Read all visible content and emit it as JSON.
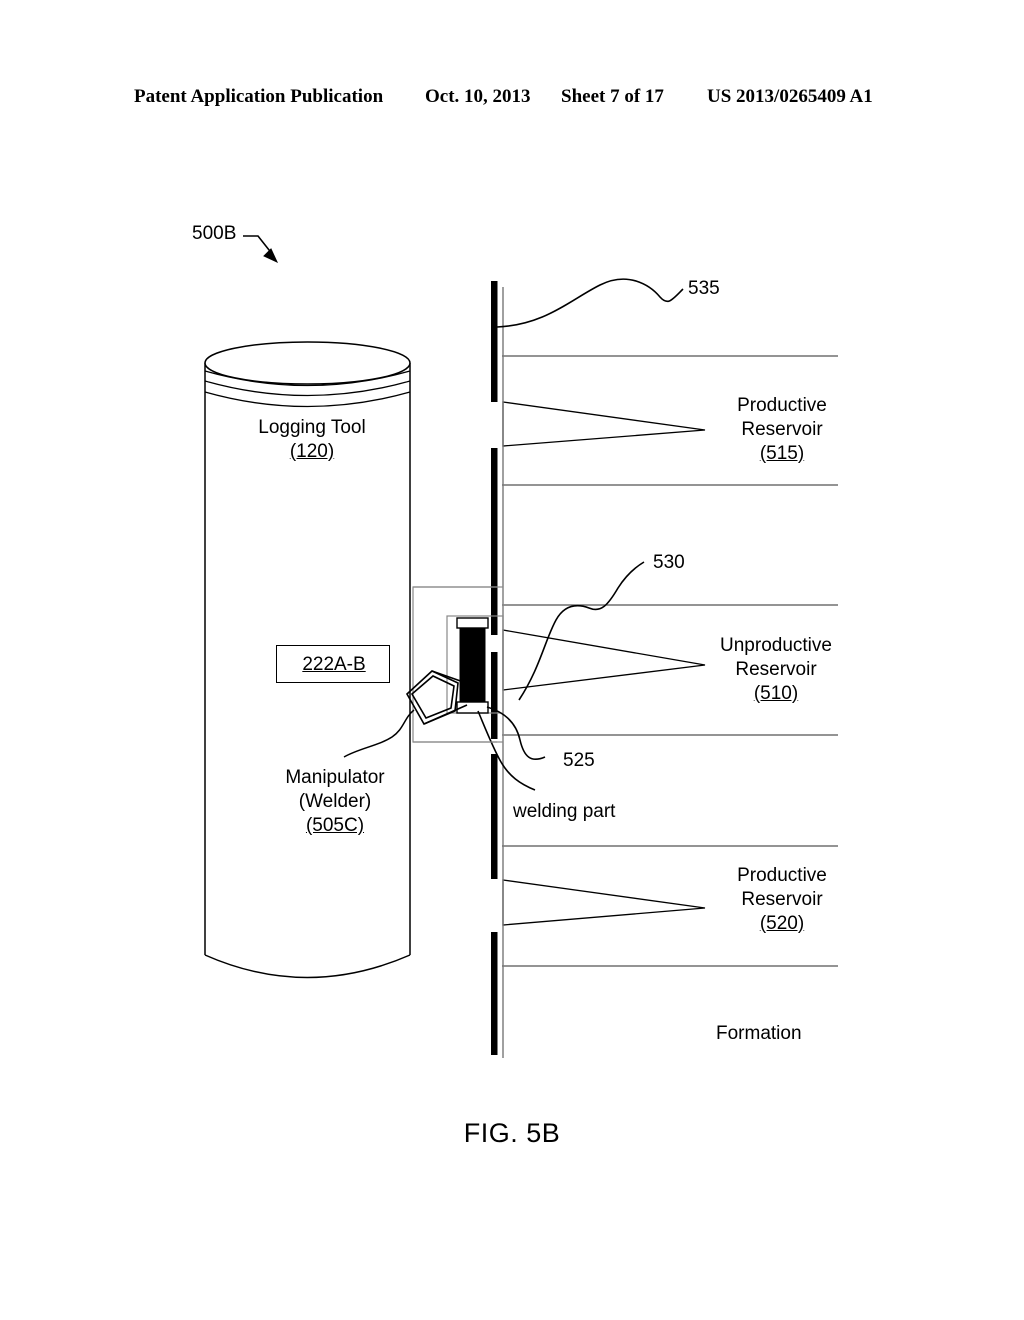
{
  "header": {
    "publication": "Patent Application Publication",
    "date": "Oct. 10, 2013",
    "sheet": "Sheet 7 of 17",
    "patent_number": "US 2013/0265409 A1"
  },
  "figure": {
    "caption": "FIG. 5B",
    "diagram_id": "500B",
    "colors": {
      "ink": "#000000",
      "paper": "#ffffff",
      "thin_line": "#4a4a4a"
    },
    "labels": {
      "logging_tool_name": "Logging Tool",
      "logging_tool_ref": "(120)",
      "manipulator_name": "Manipulator",
      "manipulator_sub": "(Welder)",
      "manipulator_ref": "(505C)",
      "module_222ab": "222A-B",
      "productive_reservoir_top_name": "Productive",
      "productive_reservoir_top_name2": "Reservoir",
      "productive_reservoir_top_ref": "(515)",
      "unproductive_reservoir_name": "Unproductive",
      "unproductive_reservoir_name2": "Reservoir",
      "unproductive_reservoir_ref": "(510)",
      "productive_reservoir_bottom_name": "Productive",
      "productive_reservoir_bottom_name2": "Reservoir",
      "productive_reservoir_bottom_ref": "(520)",
      "formation": "Formation",
      "welding_part": "welding part",
      "ref_535": "535",
      "ref_530": "530",
      "ref_525": "525"
    }
  }
}
